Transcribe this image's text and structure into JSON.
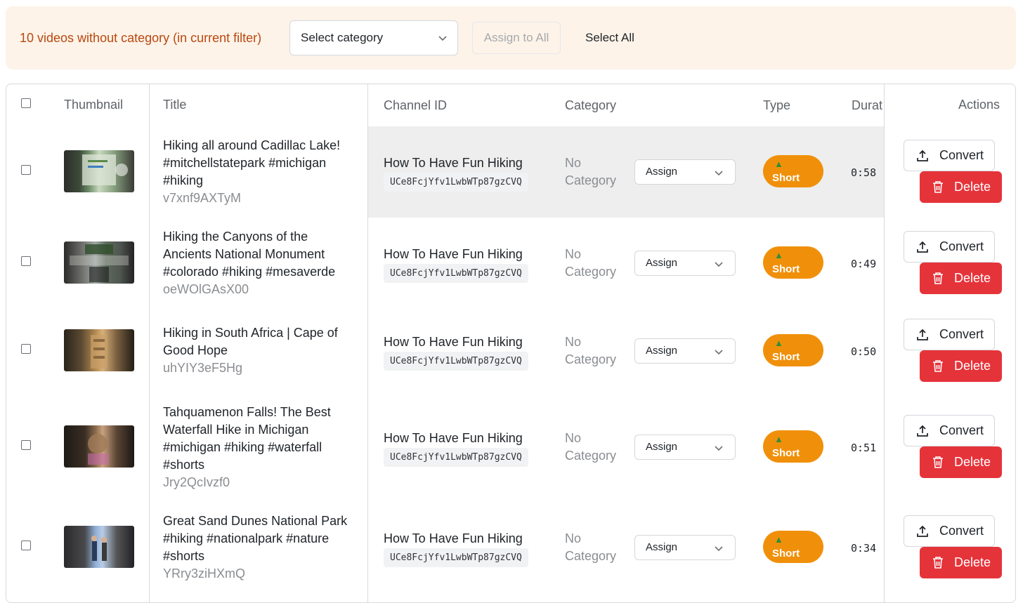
{
  "banner": {
    "message": "10 videos without category (in current filter)",
    "category_select_label": "Select category",
    "assign_all_label": "Assign to All",
    "select_all_label": "Select All"
  },
  "table": {
    "headers": {
      "thumbnail": "Thumbnail",
      "title": "Title",
      "channel_id": "Channel ID",
      "category": "Category",
      "type": "Type",
      "duration": "Durat",
      "actions": "Actions"
    },
    "rows": [
      {
        "title_lines": [
          "Hiking all around Cadillac Lake!",
          "#mitchellstatepark #michigan",
          "#hiking"
        ],
        "video_id": "v7xnf9AXTyM",
        "channel_name": "How To Have Fun Hiking",
        "channel_id": "UCe8FcjYfv1LwbWTp87gzCVQ",
        "category_lines": [
          "No",
          "Category"
        ],
        "assign_label": "Assign",
        "type": "Short",
        "duration": "0:58",
        "convert_label": "Convert",
        "delete_label": "Delete"
      },
      {
        "title_lines": [
          "Hiking the Canyons of the",
          "Ancients National Monument",
          "#colorado #hiking #mesaverde"
        ],
        "video_id": "oeWOlGAsX00",
        "channel_name": "How To Have Fun Hiking",
        "channel_id": "UCe8FcjYfv1LwbWTp87gzCVQ",
        "category_lines": [
          "No",
          "Category"
        ],
        "assign_label": "Assign",
        "type": "Short",
        "duration": "0:49",
        "convert_label": "Convert",
        "delete_label": "Delete"
      },
      {
        "title_lines": [
          "Hiking in South Africa | Cape of",
          "Good Hope"
        ],
        "video_id": "uhYIY3eF5Hg",
        "channel_name": "How To Have Fun Hiking",
        "channel_id": "UCe8FcjYfv1LwbWTp87gzCVQ",
        "category_lines": [
          "No",
          "Category"
        ],
        "assign_label": "Assign",
        "type": "Short",
        "duration": "0:50",
        "convert_label": "Convert",
        "delete_label": "Delete"
      },
      {
        "title_lines": [
          "Tahquamenon Falls! The Best",
          "Waterfall Hike in Michigan",
          "#michigan #hiking #waterfall",
          "#shorts"
        ],
        "video_id": "Jry2QcIvzf0",
        "channel_name": "How To Have Fun Hiking",
        "channel_id": "UCe8FcjYfv1LwbWTp87gzCVQ",
        "category_lines": [
          "No",
          "Category"
        ],
        "assign_label": "Assign",
        "type": "Short",
        "duration": "0:51",
        "convert_label": "Convert",
        "delete_label": "Delete"
      },
      {
        "title_lines": [
          "Great Sand Dunes National Park",
          "#hiking #nationalpark #nature",
          "#shorts"
        ],
        "video_id": "YRry3ziHXmQ",
        "channel_name": "How To Have Fun Hiking",
        "channel_id": "UCe8FcjYfv1LwbWTp87gzCVQ",
        "category_lines": [
          "No",
          "Category"
        ],
        "assign_label": "Assign",
        "type": "Short",
        "duration": "0:34",
        "convert_label": "Convert",
        "delete_label": "Delete"
      }
    ]
  },
  "colors": {
    "banner_bg": "#fdf3e9",
    "banner_text": "#b94810",
    "type_badge": "#f0900a",
    "delete_button": "#e5333a"
  }
}
